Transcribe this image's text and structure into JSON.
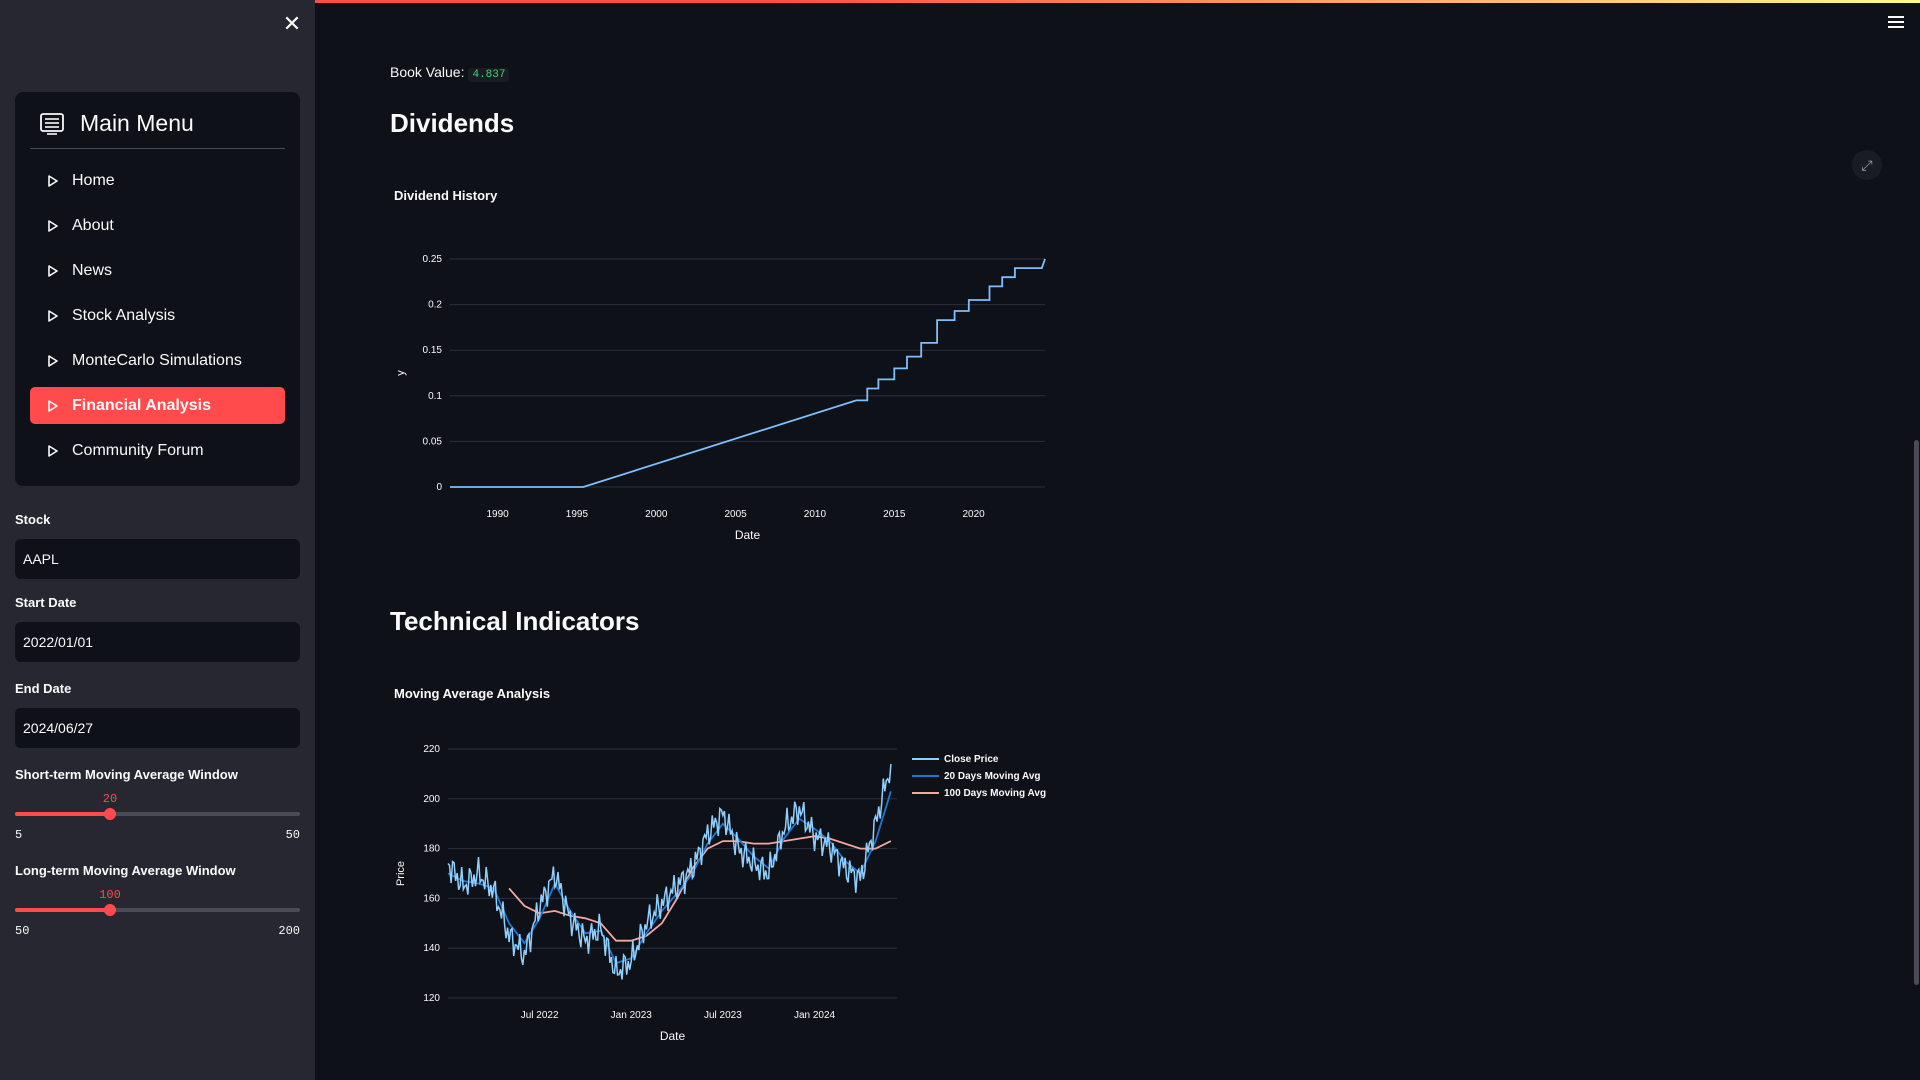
{
  "sidebar": {
    "menu_title": "Main Menu",
    "items": [
      {
        "label": "Home",
        "active": false
      },
      {
        "label": "About",
        "active": false
      },
      {
        "label": "News",
        "active": false
      },
      {
        "label": "Stock Analysis",
        "active": false
      },
      {
        "label": "MonteCarlo Simulations",
        "active": false
      },
      {
        "label": "Financial Analysis",
        "active": true
      },
      {
        "label": "Community Forum",
        "active": false
      }
    ],
    "stock": {
      "label": "Stock",
      "value": "AAPL"
    },
    "start_date": {
      "label": "Start Date",
      "value": "2022/01/01"
    },
    "end_date": {
      "label": "End Date",
      "value": "2024/06/27"
    },
    "short_slider": {
      "label": "Short-term Moving Average Window",
      "value": 20,
      "min": 5,
      "max": 50,
      "value_text": "20",
      "min_text": "5",
      "max_text": "50"
    },
    "long_slider": {
      "label": "Long-term Moving Average Window",
      "value": 100,
      "min": 50,
      "max": 200,
      "value_text": "100",
      "min_text": "50",
      "max_text": "200"
    }
  },
  "main": {
    "book_value_label": "Book Value:",
    "book_value": "4.837",
    "dividends_heading": "Dividends",
    "technical_heading": "Technical Indicators"
  },
  "colors": {
    "accent": "#ff4b4b",
    "background": "#0e1117",
    "sidebar": "#262730"
  },
  "chart_data": [
    {
      "type": "line",
      "title": "Dividend History",
      "xlabel": "Date",
      "ylabel": "y",
      "xlim": [
        1987,
        2024.5
      ],
      "ylim": [
        0,
        0.25
      ],
      "x_ticks": [
        "1990",
        "1995",
        "2000",
        "2005",
        "2010",
        "2015",
        "2020"
      ],
      "y_ticks": [
        "0",
        "0.05",
        "0.1",
        "0.15",
        "0.2",
        "0.25"
      ],
      "series": [
        {
          "color": "#7fbfff",
          "x": [
            1987.0,
            1995.4,
            2012.6,
            2013.3,
            2013.3,
            2014.0,
            2014.0,
            2015.0,
            2015.0,
            2015.8,
            2015.8,
            2016.7,
            2016.7,
            2017.7,
            2017.7,
            2018.3,
            2018.3,
            2018.8,
            2018.8,
            2019.7,
            2019.7,
            2020.3,
            2020.3,
            2021.0,
            2021.0,
            2021.8,
            2021.8,
            2022.6,
            2022.6,
            2023.6,
            2023.6,
            2024.3,
            2024.5
          ],
          "y": [
            0.0,
            0.0,
            0.095,
            0.095,
            0.108,
            0.108,
            0.118,
            0.118,
            0.13,
            0.13,
            0.143,
            0.143,
            0.158,
            0.158,
            0.183,
            0.183,
            0.183,
            0.183,
            0.193,
            0.193,
            0.205,
            0.205,
            0.205,
            0.205,
            0.22,
            0.22,
            0.23,
            0.23,
            0.24,
            0.24,
            0.24,
            0.24,
            0.25
          ]
        }
      ]
    },
    {
      "type": "line",
      "title": "Moving Average Analysis",
      "xlabel": "Date",
      "ylabel": "Price",
      "ylim": [
        120,
        220
      ],
      "x_ticks": [
        "Jul 2022",
        "Jan 2023",
        "Jul 2023",
        "Jan 2024"
      ],
      "y_ticks": [
        "120",
        "140",
        "160",
        "180",
        "200",
        "220"
      ],
      "legend_position": "top-right",
      "series": [
        {
          "name": "Close Price",
          "color": "#8fd0ff",
          "x": [
            "2022-01",
            "2022-02",
            "2022-03",
            "2022-04",
            "2022-05",
            "2022-06",
            "2022-07",
            "2022-08",
            "2022-09",
            "2022-10",
            "2022-11",
            "2022-12",
            "2023-01",
            "2023-02",
            "2023-03",
            "2023-04",
            "2023-05",
            "2023-06",
            "2023-07",
            "2023-08",
            "2023-09",
            "2023-10",
            "2023-11",
            "2023-12",
            "2024-01",
            "2024-02",
            "2024-03",
            "2024-04",
            "2024-05",
            "2024-06"
          ],
          "y": [
            174,
            165,
            170,
            163,
            145,
            137,
            157,
            170,
            152,
            143,
            148,
            130,
            135,
            150,
            158,
            165,
            172,
            186,
            194,
            180,
            174,
            170,
            188,
            196,
            185,
            181,
            172,
            168,
            190,
            214
          ]
        },
        {
          "name": "20 Days Moving Avg",
          "color": "#1f77d4",
          "x": [
            "2022-01",
            "2022-02",
            "2022-03",
            "2022-04",
            "2022-05",
            "2022-06",
            "2022-07",
            "2022-08",
            "2022-09",
            "2022-10",
            "2022-11",
            "2022-12",
            "2023-01",
            "2023-02",
            "2023-03",
            "2023-04",
            "2023-05",
            "2023-06",
            "2023-07",
            "2023-08",
            "2023-09",
            "2023-10",
            "2023-11",
            "2023-12",
            "2024-01",
            "2024-02",
            "2024-03",
            "2024-04",
            "2024-05",
            "2024-06"
          ],
          "y": [
            170,
            167,
            166,
            164,
            150,
            142,
            152,
            166,
            155,
            146,
            147,
            134,
            136,
            146,
            155,
            162,
            170,
            182,
            190,
            184,
            177,
            172,
            184,
            192,
            188,
            183,
            175,
            170,
            183,
            203
          ]
        },
        {
          "name": "100 Days Moving Avg",
          "color": "#f4a6a0",
          "x": [
            "2022-05",
            "2022-06",
            "2022-07",
            "2022-08",
            "2022-09",
            "2022-10",
            "2022-11",
            "2022-12",
            "2023-01",
            "2023-02",
            "2023-03",
            "2023-04",
            "2023-05",
            "2023-06",
            "2023-07",
            "2023-08",
            "2023-09",
            "2023-10",
            "2023-11",
            "2023-12",
            "2024-01",
            "2024-02",
            "2024-03",
            "2024-04",
            "2024-05",
            "2024-06"
          ],
          "y": [
            164,
            157,
            154,
            155,
            153,
            152,
            150,
            143,
            143,
            145,
            150,
            160,
            172,
            180,
            183,
            183,
            182,
            182,
            183,
            184,
            185,
            184,
            182,
            180,
            180,
            183
          ]
        }
      ]
    }
  ]
}
